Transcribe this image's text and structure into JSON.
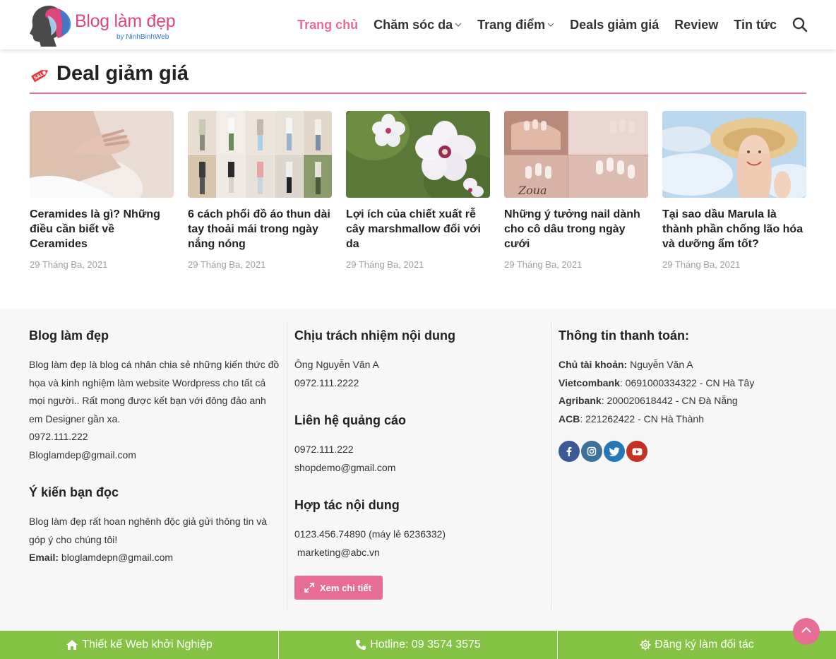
{
  "header": {
    "logo_title": "Blog làm đẹp",
    "logo_sub": "by NinhBinhWeb",
    "nav": [
      {
        "label": "Trang chủ",
        "active": true
      },
      {
        "label": "Chăm sóc da",
        "dropdown": true
      },
      {
        "label": "Trang điểm",
        "dropdown": true
      },
      {
        "label": "Deals giảm giá"
      },
      {
        "label": "Review"
      },
      {
        "label": "Tin tức"
      }
    ]
  },
  "deals": {
    "title": "Deal giảm giá",
    "posts": [
      {
        "title": "Ceramides là gì? Những điều cần biết về Ceramides",
        "date": "29 Tháng Ba, 2021"
      },
      {
        "title": "6 cách phối đồ áo thun dài tay thoải mái trong ngày nắng nóng",
        "date": "29 Tháng Ba, 2021"
      },
      {
        "title": "Lợi ích của chiết xuất rễ cây marshmallow đối với da",
        "date": "29 Tháng Ba, 2021"
      },
      {
        "title": "Những ý tưởng nail dành cho cô dâu trong ngày cưới",
        "date": "29 Tháng Ba, 2021"
      },
      {
        "title": "Tại sao dầu Marula là thành phần chống lão hóa và dưỡng ẩm tốt?",
        "date": "29 Tháng Ba, 2021"
      }
    ]
  },
  "footer": {
    "col1": {
      "title": "Blog làm đẹp",
      "desc": "Blog làm đẹp là blog cá nhân chia sẻ những kiến thức đồ họa và kinh nghiệm làm website Wordpress cho tất cả mọi người.. Rất mong được kết bạn với đông đảo anh em Designer gần xa.",
      "phone": "0972.111.222",
      "email": "Bloglamdep@gmail.com",
      "title2": "Ý kiến bạn đọc",
      "desc2": "Blog làm đẹp rất hoan nghênh độc giả gửi thông tin và góp ý cho chúng tôi!",
      "email_label": "Email:",
      "email2": "bloglamdepn@gmail.com"
    },
    "col2": {
      "title": "Chịu trách nhiệm nội dung",
      "name": "Ông Nguyễn Văn A",
      "phone": "0972.111.2222",
      "title2": "Liên hệ quảng cáo",
      "phone2": "0972.111.222",
      "email2": "shopdemo@gmail.com",
      "title3": "Hợp tác nội dung",
      "phone3": "0123.456.74890 (máy lẻ 6236332)",
      "email3": " marketing@abc.vn",
      "button": "Xem chi tiết"
    },
    "col3": {
      "title": "Thông tin thanh toán:",
      "owner_label": "Chủ tài khoản:",
      "owner": " Nguyễn Văn A",
      "banks": [
        {
          "name": "Vietcombank",
          "info": ": 0691000334322 - CN Hà Tây"
        },
        {
          "name": "Agribank",
          "info": ": 200020618442 - CN Đà Nẵng"
        },
        {
          "name": "ACB",
          "info": ": 221262422 - CN Hà Thành"
        }
      ],
      "social_colors": {
        "facebook": "#3b5998",
        "instagram": "#3f729b",
        "twitter": "#2478ba",
        "youtube": "#c33223"
      }
    }
  },
  "bottombar": {
    "item1": "Thiết kế Web khởi Nghiệp",
    "item2": "Hotline: 09 3574 3575",
    "item3": "Đăng ký làm đối tác"
  },
  "colors": {
    "accent": "#e86d95",
    "green": "#85c344"
  }
}
